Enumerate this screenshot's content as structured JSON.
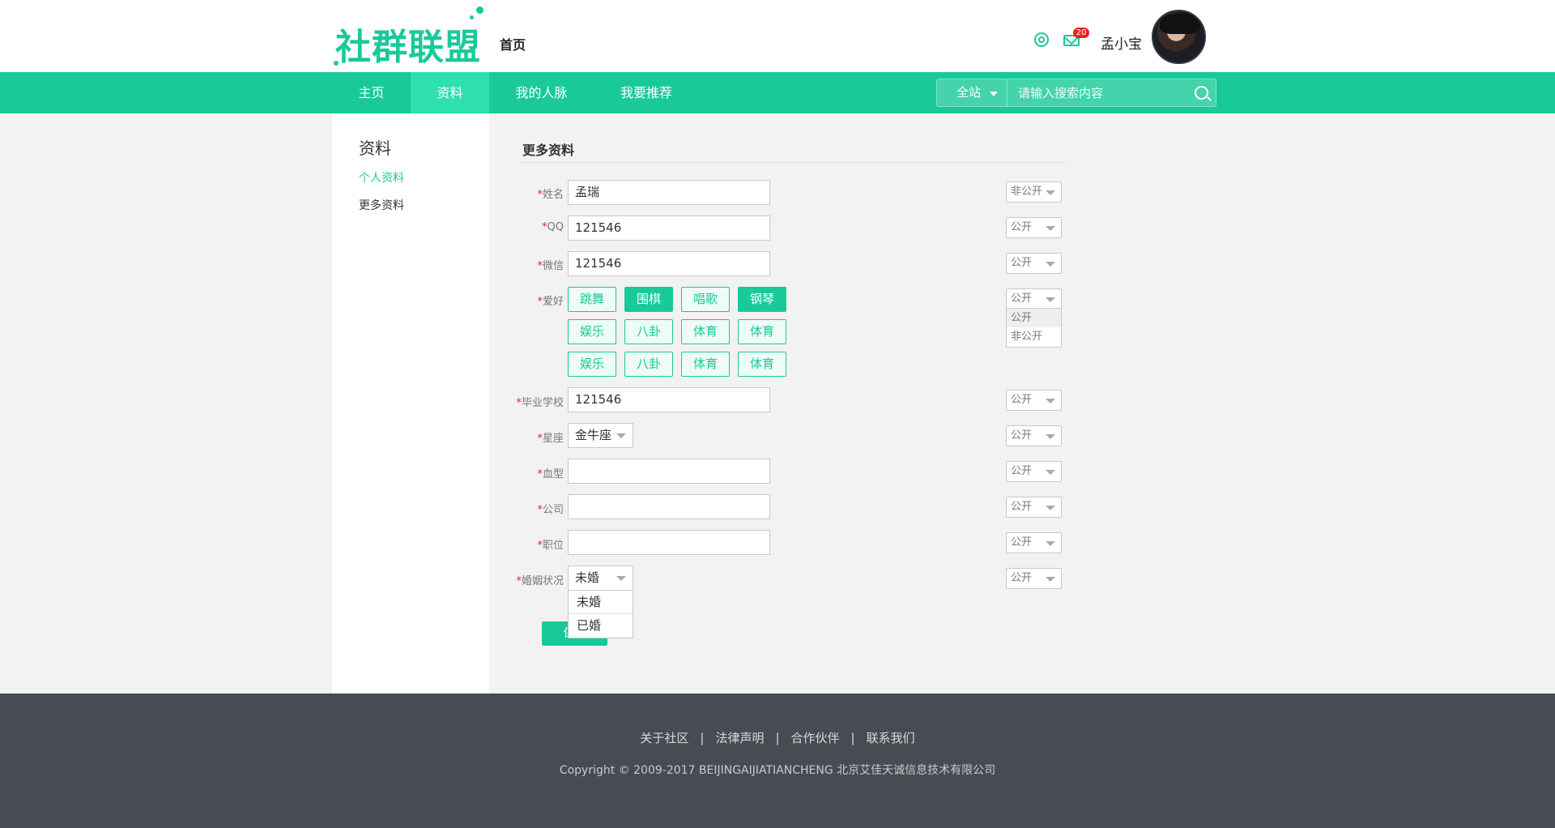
{
  "brand": {
    "logo_text": "社群联盟",
    "home_label": "首页",
    "accent": "#1ac99a"
  },
  "user": {
    "name": "孟小宝",
    "mail_count": "20"
  },
  "nav": {
    "items": [
      {
        "label": "主页"
      },
      {
        "label": "资料"
      },
      {
        "label": "我的人脉"
      },
      {
        "label": "我要推荐"
      }
    ],
    "active": "资料"
  },
  "search": {
    "scope": "全站",
    "placeholder": "请输入搜索内容"
  },
  "sidebar": {
    "title": "资料",
    "items": [
      {
        "label": "个人资料"
      },
      {
        "label": "更多资料"
      }
    ]
  },
  "form": {
    "title": "更多资料",
    "required_mark": "*",
    "fields": {
      "name": {
        "label": "姓名",
        "value": "孟瑞",
        "privacy": "非公开"
      },
      "qq": {
        "label": "QQ",
        "value": "121546",
        "privacy": "公开"
      },
      "wechat": {
        "label": "微信",
        "value": "121546",
        "privacy": "公开"
      },
      "hobby": {
        "label": "爱好",
        "privacy": "公开"
      },
      "school": {
        "label": "毕业学校",
        "value": "121546",
        "privacy": "公开"
      },
      "zodiac": {
        "label": "星座",
        "value": "金牛座",
        "privacy": "公开"
      },
      "blood": {
        "label": "血型",
        "value": "",
        "privacy": "公开"
      },
      "company": {
        "label": "公司",
        "value": "",
        "privacy": "公开"
      },
      "position": {
        "label": "职位",
        "value": "",
        "privacy": "公开"
      },
      "marriage": {
        "label": "婚姻状况",
        "value": "未婚",
        "privacy": "公开"
      }
    },
    "hobby_tags": [
      {
        "label": "跳舞",
        "selected": false
      },
      {
        "label": "围棋",
        "selected": true
      },
      {
        "label": "唱歌",
        "selected": false
      },
      {
        "label": "钢琴",
        "selected": true
      },
      {
        "label": "娱乐",
        "selected": false
      },
      {
        "label": "八卦",
        "selected": false
      },
      {
        "label": "体育",
        "selected": false
      },
      {
        "label": "体育",
        "selected": false
      },
      {
        "label": "娱乐",
        "selected": false
      },
      {
        "label": "八卦",
        "selected": false
      },
      {
        "label": "体育",
        "selected": false
      },
      {
        "label": "体育",
        "selected": false
      }
    ],
    "privacy_options": [
      "公开",
      "非公开"
    ],
    "marriage_options": [
      "未婚",
      "已婚"
    ],
    "save_label": "保存"
  },
  "footer": {
    "links": [
      {
        "label": "关于社区"
      },
      {
        "label": "法律声明"
      },
      {
        "label": "合作伙伴"
      },
      {
        "label": "联系我们"
      }
    ],
    "separator": "|",
    "copyright": "Copyright © 2009-2017 BEIJINGAIJIATIANCHENG 北京艾佳天诚信息技术有限公司"
  }
}
